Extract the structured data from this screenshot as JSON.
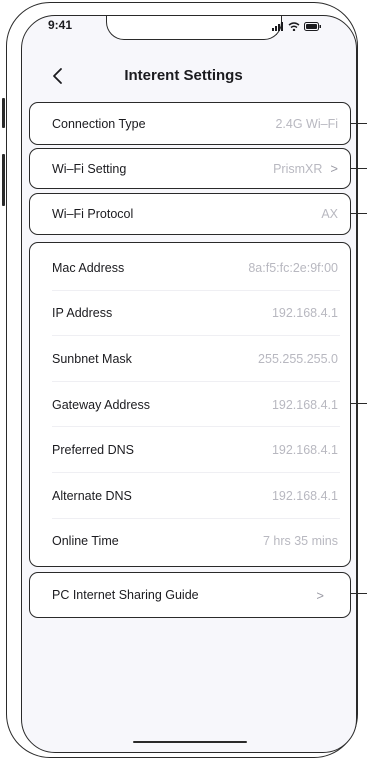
{
  "status": {
    "time": "9:41"
  },
  "nav": {
    "title": "Interent Settings"
  },
  "rows": {
    "connection_type": {
      "label": "Connection Type",
      "value": "2.4G Wi–Fi"
    },
    "wifi_setting": {
      "label": "Wi–Fi Setting",
      "value": "PrismXR",
      "chevron": ">"
    },
    "wifi_protocol": {
      "label": "Wi–Fi Protocol",
      "value": "AX"
    }
  },
  "info": [
    {
      "label": "Mac Address",
      "value": "8a:f5:fc:2e:9f:00"
    },
    {
      "label": "IP Address",
      "value": "192.168.4.1"
    },
    {
      "label": "Sunbnet Mask",
      "value": "255.255.255.0"
    },
    {
      "label": "Gateway Address",
      "value": "192.168.4.1"
    },
    {
      "label": "Preferred DNS",
      "value": "192.168.4.1"
    },
    {
      "label": "Alternate DNS",
      "value": "192.168.4.1"
    },
    {
      "label": "Online Time",
      "value": "7 hrs 35 mins"
    }
  ],
  "guide": {
    "label": "PC Internet Sharing Guide",
    "chevron": ">"
  },
  "icons": [
    "back-chevron-icon",
    "signal-icon",
    "wifi-icon",
    "battery-icon",
    "chevron-right-icon"
  ],
  "colors": {
    "frame": "#2a2a2a",
    "label": "#1b1b1f",
    "value": "#b8b8c0",
    "background": "#f7f7fb"
  }
}
